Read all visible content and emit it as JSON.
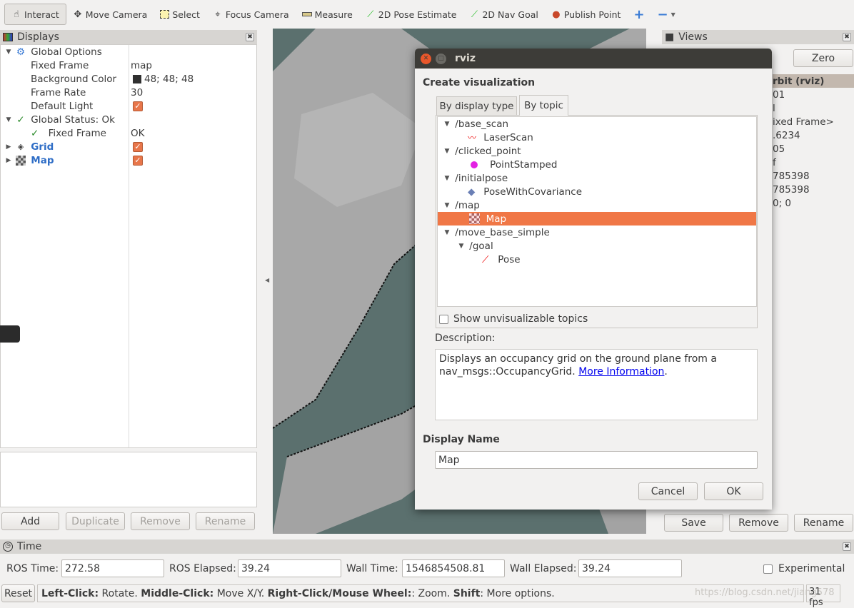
{
  "toolbar": {
    "items": [
      {
        "label": "Interact",
        "icon": "hand-pointer-icon",
        "active": true
      },
      {
        "label": "Move Camera",
        "icon": "move-camera-icon"
      },
      {
        "label": "Select",
        "icon": "select-box-icon"
      },
      {
        "label": "Focus Camera",
        "icon": "focus-crosshair-icon"
      },
      {
        "label": "Measure",
        "icon": "ruler-icon"
      },
      {
        "label": "2D Pose Estimate",
        "icon": "green-arrow-icon"
      },
      {
        "label": "2D Nav Goal",
        "icon": "green-arrow-icon"
      },
      {
        "label": "Publish Point",
        "icon": "map-pin-icon"
      }
    ],
    "add": "+",
    "remove": "−"
  },
  "displays": {
    "title": "Displays",
    "global_options": "Global Options",
    "fixed_frame": {
      "label": "Fixed Frame",
      "value": "map"
    },
    "background_color": {
      "label": "Background Color",
      "value": "48; 48; 48",
      "swatch": "#303030"
    },
    "frame_rate": {
      "label": "Frame Rate",
      "value": "30"
    },
    "default_light": {
      "label": "Default Light",
      "checked": true
    },
    "global_status": "Global Status: Ok",
    "status_fixed_frame": {
      "label": "Fixed Frame",
      "value": "OK"
    },
    "grid": {
      "label": "Grid",
      "checked": true
    },
    "map": {
      "label": "Map",
      "checked": true
    },
    "buttons": {
      "add": "Add",
      "duplicate": "Duplicate",
      "remove": "Remove",
      "rename": "Rename"
    }
  },
  "views": {
    "title": "Views",
    "zero": "Zero",
    "current": "rbit (rviz)",
    "values": [
      "01",
      "l",
      "ixed Frame>",
      ".6234",
      "05",
      "f",
      "785398",
      "785398",
      "0; 0"
    ],
    "buttons": {
      "save": "Save",
      "remove": "Remove",
      "rename": "Rename"
    }
  },
  "dialog": {
    "title": "rviz",
    "heading": "Create visualization",
    "tabs": [
      "By display type",
      "By topic"
    ],
    "active_tab": 1,
    "topics": [
      {
        "topic": "/base_scan",
        "type": "LaserScan",
        "icon": "laser-scan-icon"
      },
      {
        "topic": "/clicked_point",
        "type": "PointStamped",
        "icon": "magenta-dot-icon"
      },
      {
        "topic": "/initialpose",
        "type": "PoseWithCovariance",
        "icon": "diamond-icon"
      },
      {
        "topic": "/map",
        "type": "Map",
        "icon": "map-grid-icon",
        "selected": true
      },
      {
        "topic": "/move_base_simple",
        "sub": "/goal",
        "type": "Pose",
        "icon": "pose-arrow-icon"
      }
    ],
    "show_unvisualizable": "Show unvisualizable topics",
    "description_label": "Description:",
    "description": "Displays an occupancy grid on the ground plane from a nav_msgs::OccupancyGrid. ",
    "more_info": "More Information",
    "period": ".",
    "display_name_label": "Display Name",
    "display_name": "Map",
    "cancel": "Cancel",
    "ok": "OK"
  },
  "time": {
    "title": "Time",
    "ros_time": {
      "label": "ROS Time:",
      "value": "272.58"
    },
    "ros_elapsed": {
      "label": "ROS Elapsed:",
      "value": "39.24"
    },
    "wall_time": {
      "label": "Wall Time:",
      "value": "1546854508.81"
    },
    "wall_elapsed": {
      "label": "Wall Elapsed:",
      "value": "39.24"
    },
    "experimental": "Experimental"
  },
  "status": {
    "reset": "Reset",
    "h1": "Left-Click:",
    "t1": " Rotate. ",
    "h2": "Middle-Click:",
    "t2": " Move X/Y. ",
    "h3": "Right-Click/Mouse Wheel:",
    "t3": ": Zoom. ",
    "h4": "Shift",
    "t4": ": More options.",
    "fps": "31 fps",
    "watermark": "https://blog.csdn.net/jiang578"
  }
}
